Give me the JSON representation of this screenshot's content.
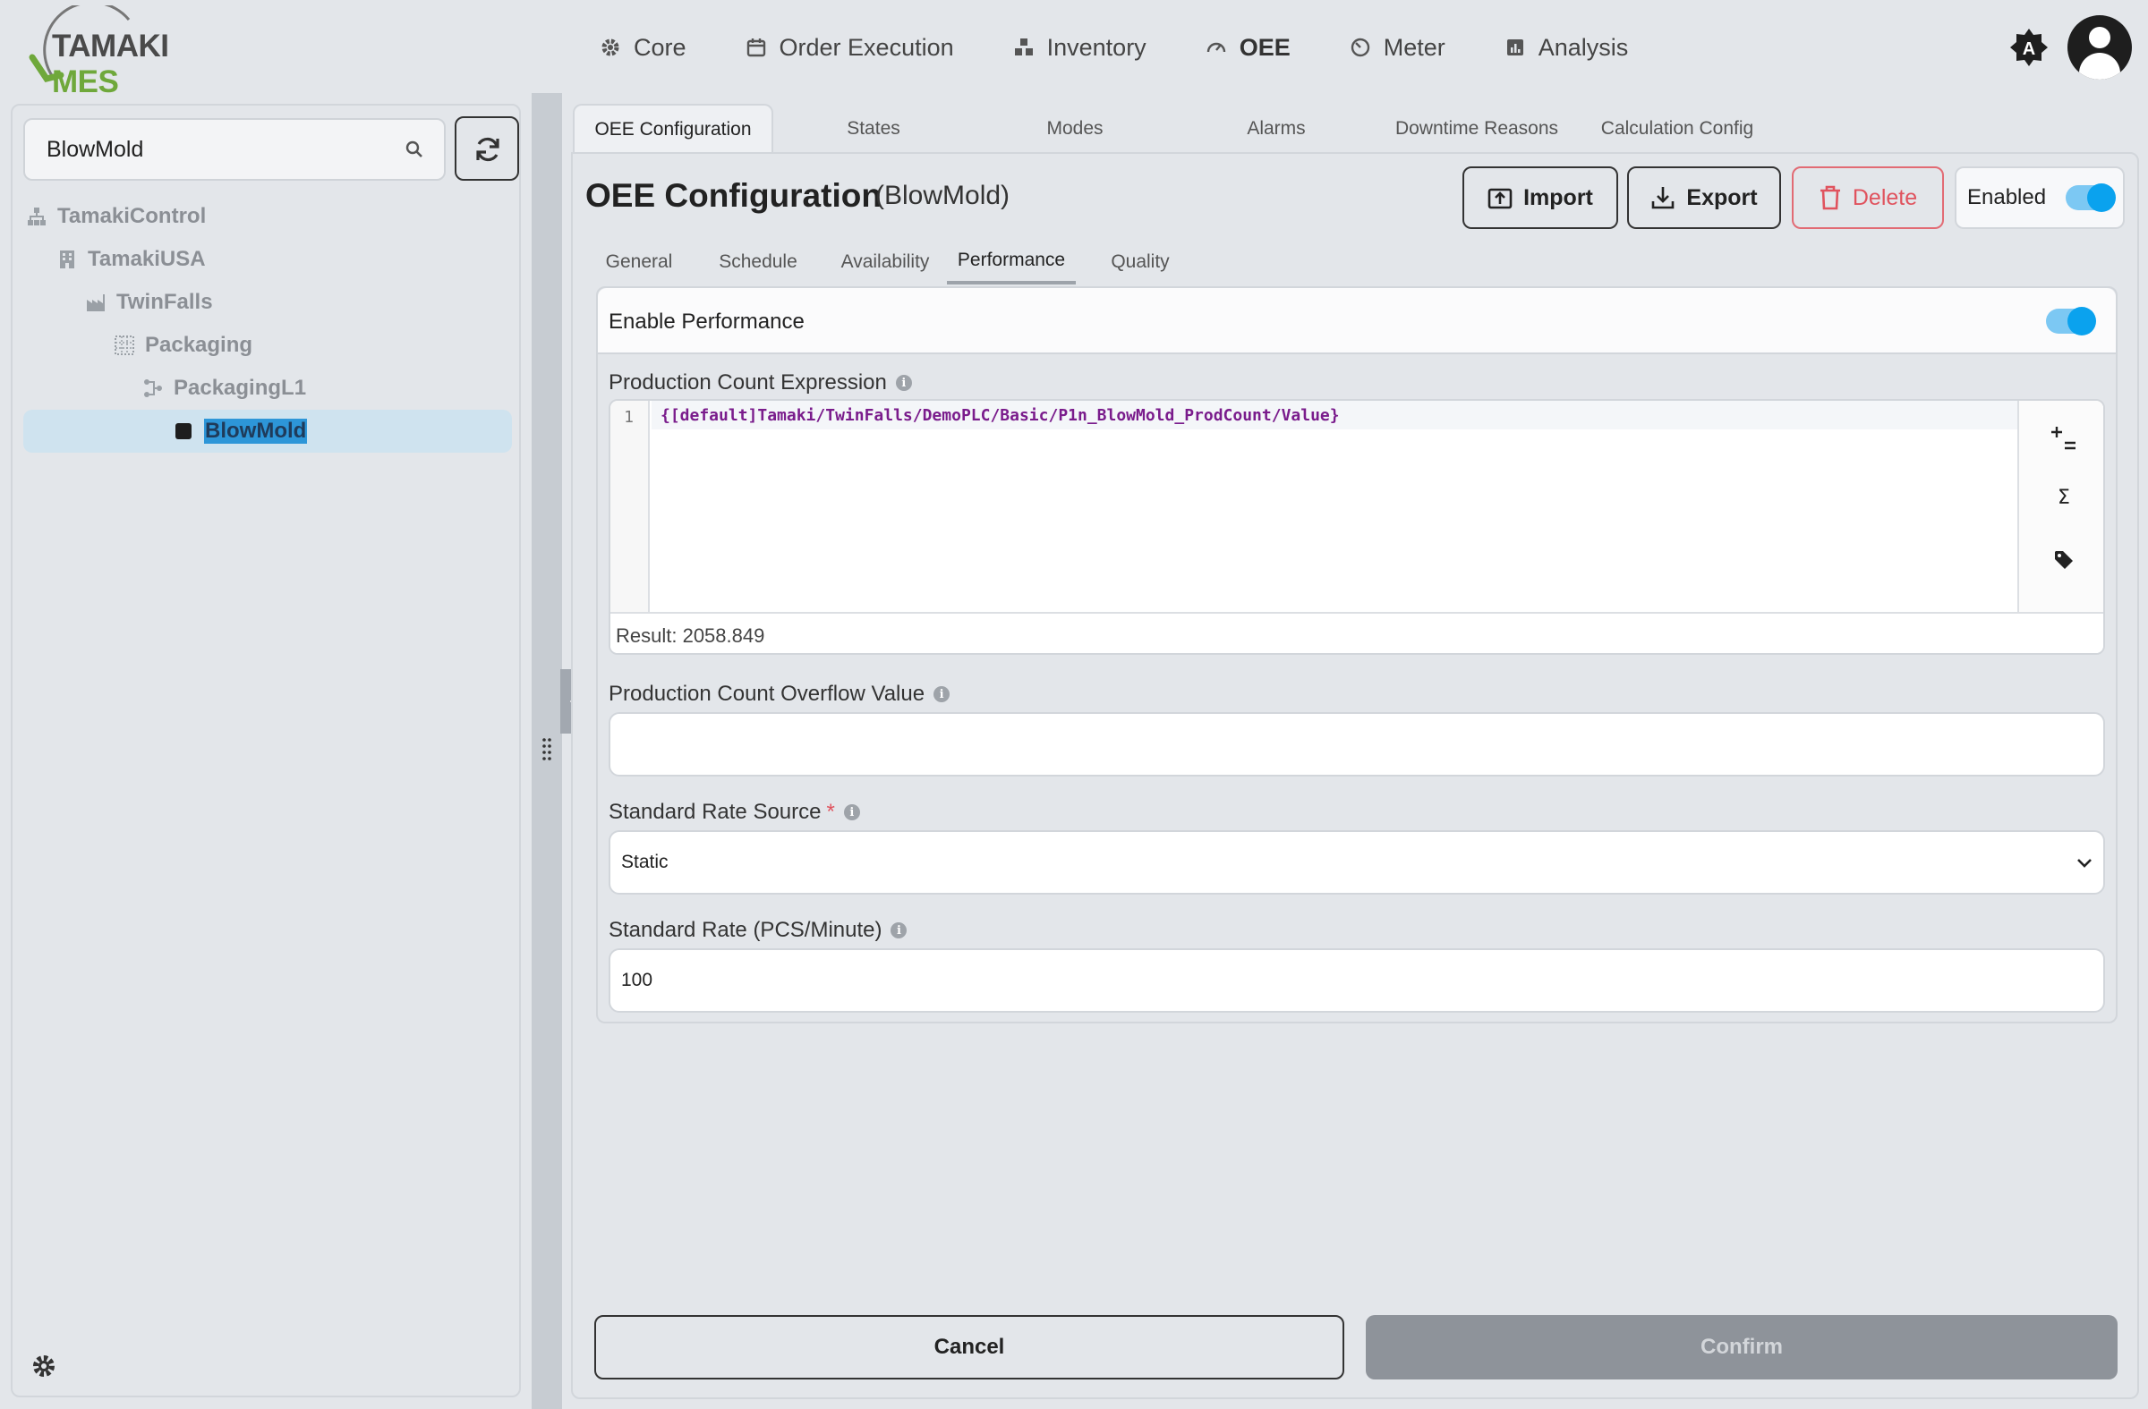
{
  "brand": {
    "name_part1": "TAMAKI",
    "name_part2": "MES",
    "accent": "#6fa83b"
  },
  "nav": {
    "items": [
      {
        "label": "Core",
        "icon": "gear-icon"
      },
      {
        "label": "Order Execution",
        "icon": "calendar-icon"
      },
      {
        "label": "Inventory",
        "icon": "boxes-icon"
      },
      {
        "label": "OEE",
        "icon": "gauge-icon",
        "active": true
      },
      {
        "label": "Meter",
        "icon": "meter-icon"
      },
      {
        "label": "Analysis",
        "icon": "chart-icon"
      }
    ]
  },
  "sidebar": {
    "search": {
      "value": "BlowMold",
      "placeholder": ""
    },
    "tree": [
      {
        "label": "TamakiControl",
        "icon": "hierarchy-icon",
        "level": 0
      },
      {
        "label": "TamakiUSA",
        "icon": "building-icon",
        "level": 1
      },
      {
        "label": "TwinFalls",
        "icon": "factory-icon",
        "level": 2
      },
      {
        "label": "Packaging",
        "icon": "area-grid-icon",
        "level": 3
      },
      {
        "label": "PackagingL1",
        "icon": "line-icon",
        "level": 4
      },
      {
        "label": "BlowMold",
        "icon": "cell-square-icon",
        "level": 5,
        "selected": true
      }
    ]
  },
  "tabs": [
    "OEE Configuration",
    "States",
    "Modes",
    "Alarms",
    "Downtime Reasons",
    "Calculation Config"
  ],
  "main": {
    "title": "OEE Configuration",
    "subtitle": "(BlowMold)",
    "import_label": "Import",
    "export_label": "Export",
    "delete_label": "Delete",
    "enabled_label": "Enabled",
    "enabled": true,
    "sub_tabs": [
      "General",
      "Schedule",
      "Availability",
      "Performance",
      "Quality"
    ],
    "active_sub_tab": "Performance",
    "performance": {
      "enable_label": "Enable Performance",
      "enabled": true,
      "expression_label": "Production Count Expression",
      "expression_line_no": "1",
      "expression": "{[default]Tamaki/TwinFalls/DemoPLC/Basic/P1n_BlowMold_ProdCount/Value}",
      "result": "Result: 2058.849",
      "overflow_label": "Production Count Overflow Value",
      "overflow_value": "",
      "rate_source_label": "Standard Rate Source",
      "rate_source_required": "*",
      "rate_source_value": "Static",
      "rate_label": "Standard Rate (PCS/Minute)",
      "rate_value": "100"
    },
    "cancel_label": "Cancel",
    "confirm_label": "Confirm"
  },
  "colors": {
    "toggle_on": "#0aa2ee",
    "delete": "#e0535e",
    "selection": "#2d96d8"
  }
}
